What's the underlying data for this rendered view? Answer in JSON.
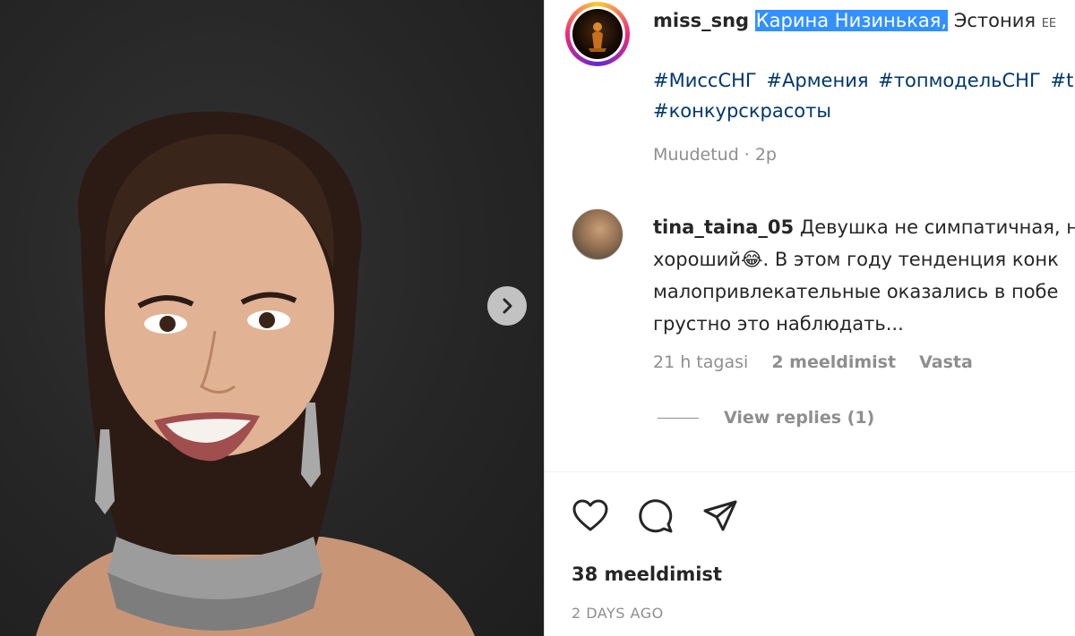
{
  "post": {
    "username": "miss_sng",
    "caption_highlighted": "Карина Низинькая,",
    "caption_rest": "Эстония",
    "flag_text": "EE",
    "hashtags": [
      "#МиссСНГ",
      "#Армения",
      "#топмодельСНГ",
      "#t",
      "#конкурскрасоты"
    ],
    "edited_label": "Muudetud",
    "edited_time": "2p"
  },
  "comment": {
    "username": "tina_taina_05",
    "text": "Девушка не симпатичная, н хороший😂. В этом году тенденция конк малопривлекательные оказались в побе грустно это наблюдать...",
    "time": "21 h tagasi",
    "likes": "2 meeldimist",
    "reply_label": "Vasta",
    "view_replies": "View replies (1)"
  },
  "footer": {
    "likes": "38 meeldimist",
    "date": "2 DAYS AGO"
  },
  "icons": {
    "like": "heart-icon",
    "comment": "comment-icon",
    "share": "share-icon",
    "next": "chevron-right-icon"
  }
}
